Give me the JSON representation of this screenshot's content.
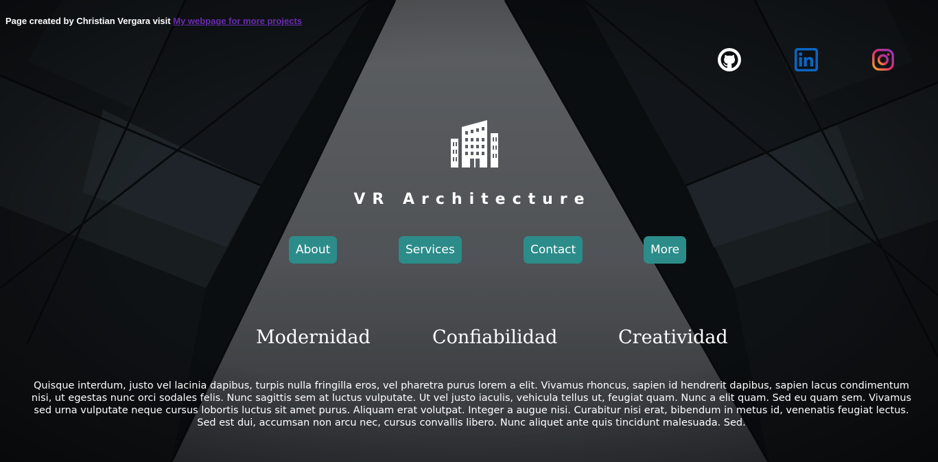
{
  "credit": {
    "prefix": "Page created by Christian Vergara visit ",
    "link_text": "My webpage for more projects"
  },
  "social": [
    {
      "name": "github",
      "icon": "github-icon"
    },
    {
      "name": "linkedin",
      "icon": "linkedin-icon"
    },
    {
      "name": "instagram",
      "icon": "instagram-icon"
    }
  ],
  "brand": {
    "logo_icon": "building-icon",
    "title": "VR Architecture"
  },
  "nav": {
    "about": "About",
    "services": "Services",
    "contact": "Contact",
    "more": "More"
  },
  "values": {
    "first": "Modernidad",
    "second": "Confiabilidad",
    "third": "Creatividad"
  },
  "description": "Quisque interdum, justo vel lacinia dapibus, turpis nulla fringilla eros, vel pharetra purus lorem a elit. Vivamus rhoncus, sapien id hendrerit dapibus, sapien lacus condimentum nisi, ut egestas nunc orci sodales felis. Nunc sagittis sem at luctus vulputate. Ut vel justo iaculis, vehicula tellus ut, feugiat quam. Nunc a elit quam. Sed eu quam sem. Vivamus sed urna vulputate neque cursus lobortis luctus sit amet purus. Aliquam erat volutpat. Integer a augue nisi. Curabitur nisi erat, bibendum in metus id, venenatis feugiat lectus. Sed est dui, accumsan non arcu nec, cursus convallis libero. Nunc aliquet ante quis tincidunt malesuada. Sed.",
  "colors": {
    "button_bg": "#2c8c8a",
    "link": "#6a2cb0",
    "text": "#ffffff",
    "linkedin": "#0a66c2"
  }
}
